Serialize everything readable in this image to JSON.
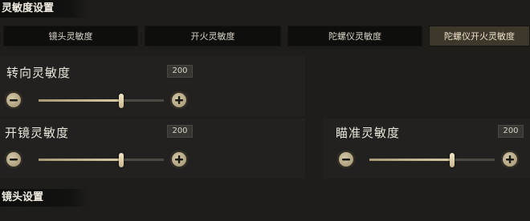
{
  "sections": {
    "sensitivity_title": "灵敏度设置",
    "lens_title": "镜头设置"
  },
  "tabs": [
    {
      "label": "镜头灵敏度",
      "active": false
    },
    {
      "label": "开火灵敏度",
      "active": false
    },
    {
      "label": "陀螺仪灵敏度",
      "active": false
    },
    {
      "label": "陀螺仪开火灵敏度",
      "active": true
    }
  ],
  "sliders": {
    "turn": {
      "label": "转向灵敏度",
      "value": "200",
      "level_percent": 66
    },
    "scope": {
      "label": "开镜灵敏度",
      "value": "200",
      "level_percent": 66
    },
    "aim": {
      "label": "瞄准灵敏度",
      "value": "200",
      "level_percent": 66
    }
  },
  "colors": {
    "accent": "#d6c9a4",
    "active_tab": "#3d372c",
    "background": "#1e1d1a"
  },
  "icons": {
    "decrease": "minus-knob-icon",
    "increase": "plus-knob-icon"
  }
}
